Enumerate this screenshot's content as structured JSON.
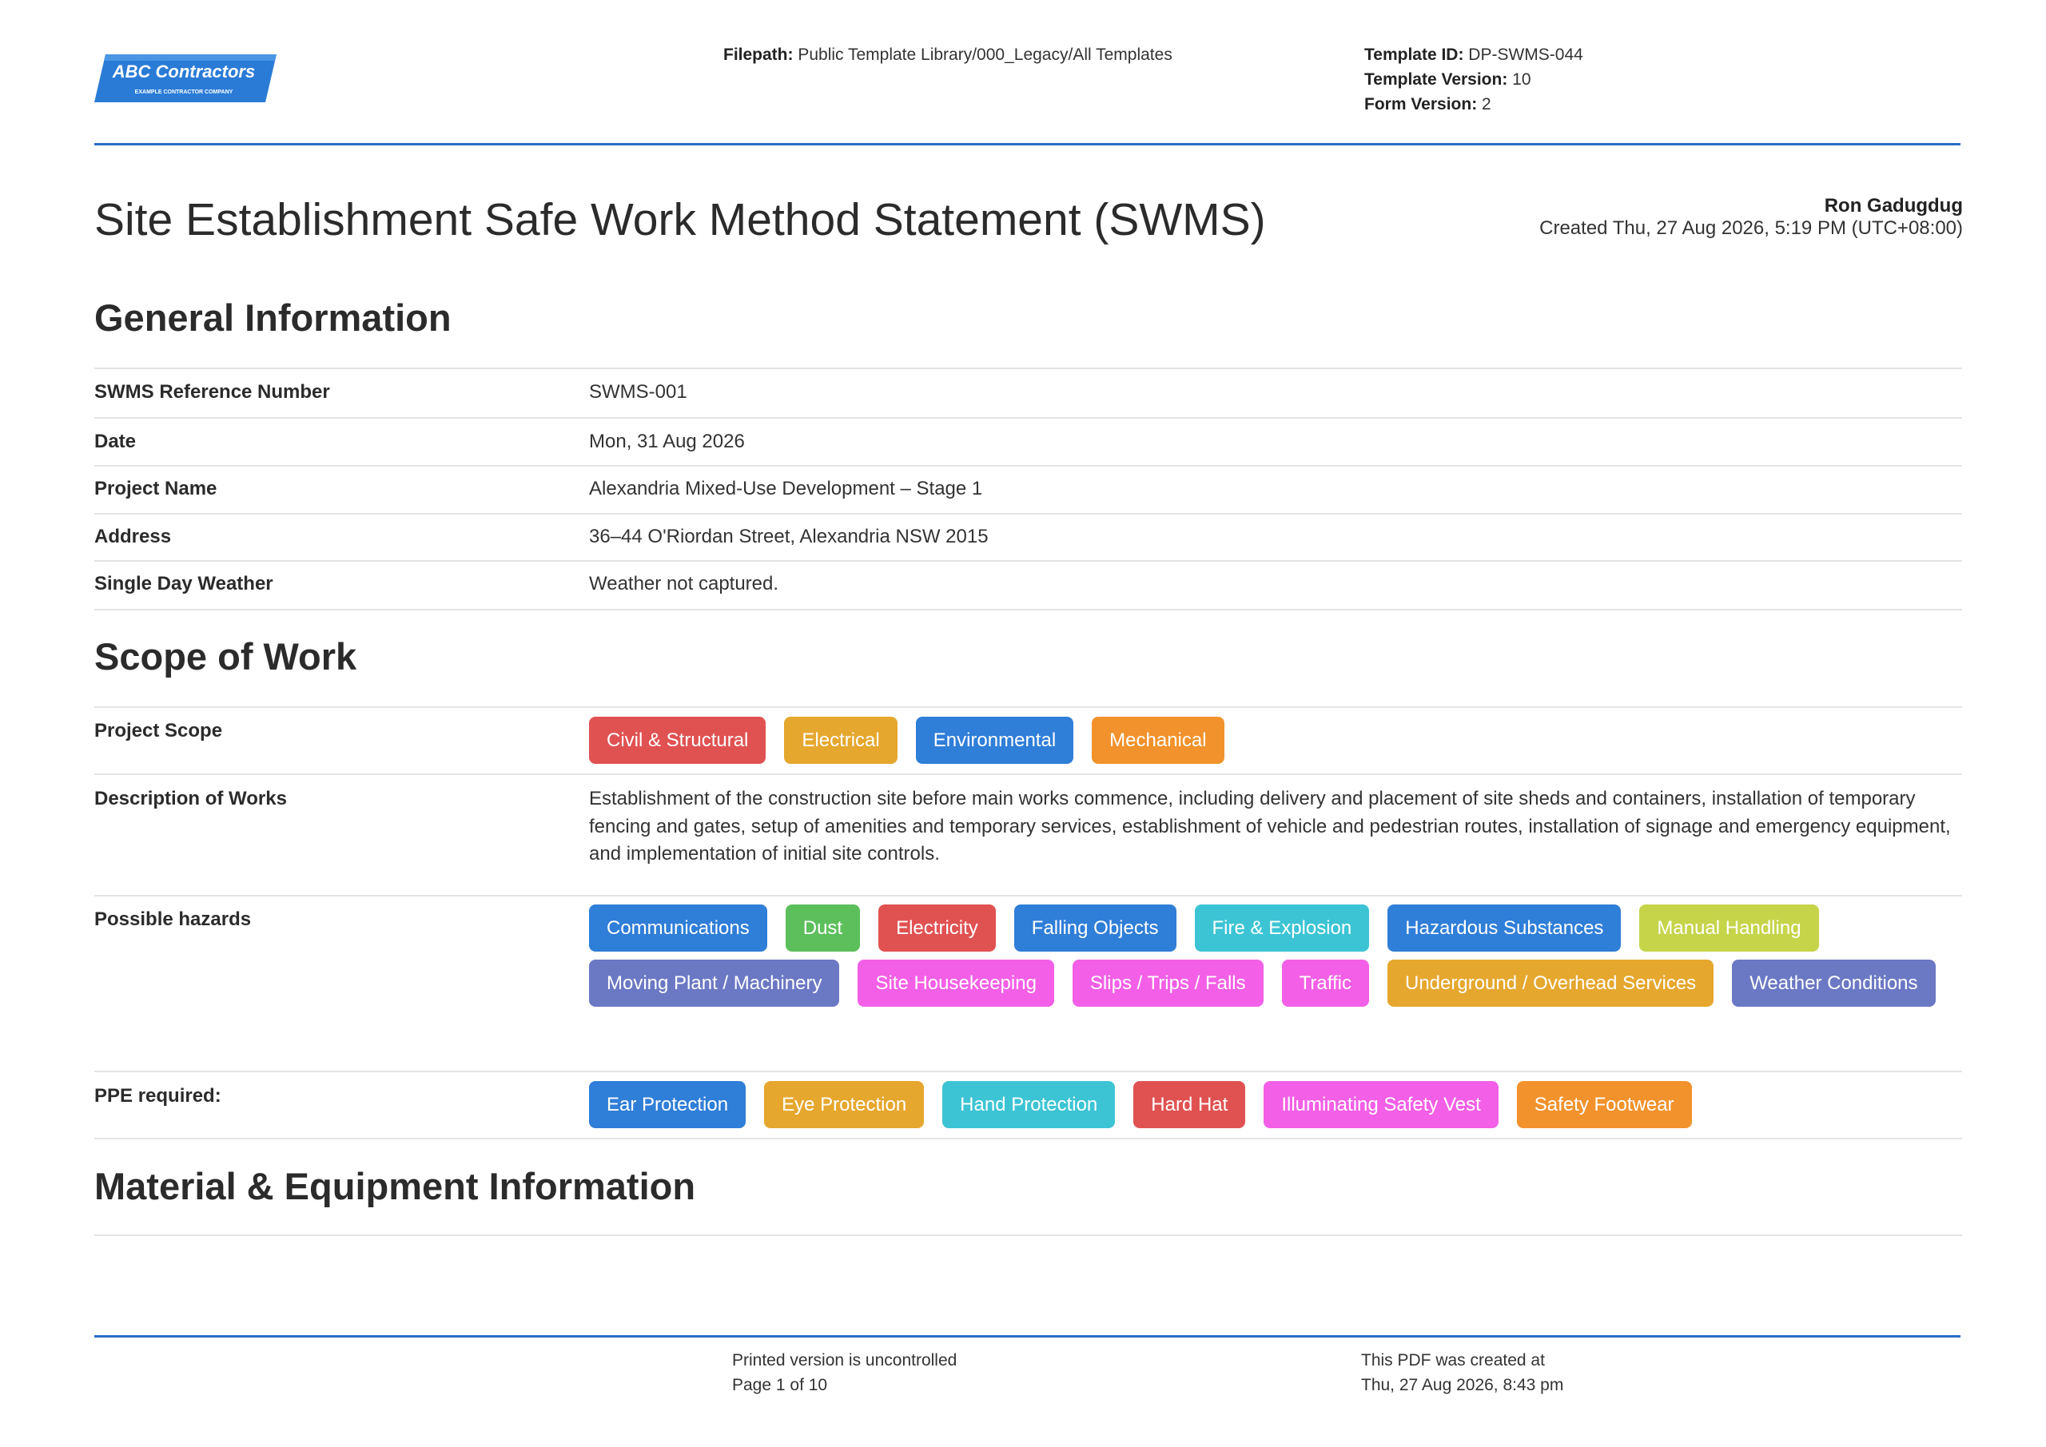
{
  "header": {
    "logo_text": "ABC Contractors",
    "logo_subtext": "EXAMPLE CONTRACTOR COMPANY",
    "filepath_label": "Filepath:",
    "filepath_value": " Public Template Library/000_Legacy/All Templates",
    "template_id_label": "Template ID:",
    "template_id_value": " DP-SWMS-044",
    "template_version_label": "Template Version:",
    "template_version_value": " 10",
    "form_version_label": "Form Version:",
    "form_version_value": " 2"
  },
  "document": {
    "title": "Site Establishment Safe Work Method Statement (SWMS)",
    "author": "Ron Gadugdug",
    "created": "Created Thu, 27 Aug 2026, 5:19 PM (UTC+08:00)"
  },
  "general_information": {
    "heading": "General Information",
    "rows": [
      {
        "label": "SWMS Reference Number",
        "value": "SWMS-001"
      },
      {
        "label": "Date",
        "value": "Mon, 31 Aug 2026"
      },
      {
        "label": "Project Name",
        "value": "Alexandria Mixed-Use Development – Stage 1"
      },
      {
        "label": "Address",
        "value": "36–44 O'Riordan Street, Alexandria NSW 2015"
      },
      {
        "label": "Single Day Weather",
        "value": "Weather not captured."
      }
    ]
  },
  "scope_of_work": {
    "heading": "Scope of Work",
    "project_scope": {
      "label": "Project Scope",
      "tags": [
        {
          "text": "Civil & Structural",
          "color": "#e05252"
        },
        {
          "text": "Electrical",
          "color": "#e6a72e"
        },
        {
          "text": "Environmental",
          "color": "#2f7ed8"
        },
        {
          "text": "Mechanical",
          "color": "#f2922c"
        }
      ]
    },
    "description": {
      "label": "Description of Works",
      "value": "Establishment of the construction site before main works commence, including delivery and placement of site sheds and containers, installation of temporary fencing and gates, setup of amenities and temporary services, establishment of vehicle and pedestrian routes, installation of signage and emergency equipment, and implementation of initial site controls."
    },
    "hazards": {
      "label": "Possible hazards",
      "tags": [
        {
          "text": "Communications",
          "color": "#2f7ed8"
        },
        {
          "text": "Dust",
          "color": "#5cbf5c"
        },
        {
          "text": "Electricity",
          "color": "#e05252"
        },
        {
          "text": "Falling Objects",
          "color": "#2f7ed8"
        },
        {
          "text": "Fire & Explosion",
          "color": "#3cc4d4"
        },
        {
          "text": "Hazardous Substances",
          "color": "#2f7ed8"
        },
        {
          "text": "Manual Handling",
          "color": "#c6d44a"
        },
        {
          "text": "Moving Plant / Machinery",
          "color": "#6b78c4"
        },
        {
          "text": "Site Housekeeping",
          "color": "#f35fe6"
        },
        {
          "text": "Slips / Trips / Falls",
          "color": "#f35fe6"
        },
        {
          "text": "Traffic",
          "color": "#f35fe6"
        },
        {
          "text": "Underground / Overhead Services",
          "color": "#e6a72e"
        },
        {
          "text": "Weather Conditions",
          "color": "#6b78c4"
        }
      ]
    },
    "ppe": {
      "label": "PPE required:",
      "tags": [
        {
          "text": "Ear Protection",
          "color": "#2f7ed8"
        },
        {
          "text": "Eye Protection",
          "color": "#e6a72e"
        },
        {
          "text": "Hand Protection",
          "color": "#3cc4d4"
        },
        {
          "text": "Hard Hat",
          "color": "#e05252"
        },
        {
          "text": "Illuminating Safety Vest",
          "color": "#f35fe6"
        },
        {
          "text": "Safety Footwear",
          "color": "#f2922c"
        }
      ]
    }
  },
  "material_equipment": {
    "heading": "Material & Equipment Information"
  },
  "footer": {
    "uncontrolled": "Printed version is uncontrolled",
    "page": "Page 1 of 10",
    "pdf_created_label": "This PDF was created at",
    "pdf_created_value": "Thu, 27 Aug 2026, 8:43 pm"
  },
  "colors": {
    "accent_line": "#2a6ec4",
    "logo_blue": "#2a7bd6"
  }
}
